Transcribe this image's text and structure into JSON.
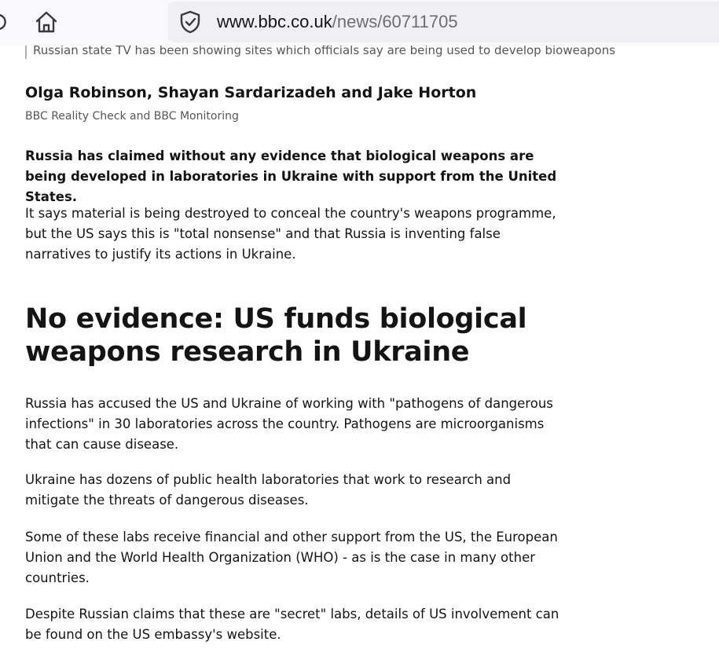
{
  "browser": {
    "url_host": "www.bbc.co.uk",
    "url_path": "/news/60711705"
  },
  "article": {
    "image_caption": "Russian state TV has been showing sites which officials say are being used to develop bioweapons",
    "byline": "Olga Robinson, Shayan Sardarizadeh and Jake Horton",
    "affiliation": "BBC Reality Check and BBC Monitoring",
    "intro": "Russia has claimed without any evidence that biological weapons are being developed in laboratories in Ukraine with support from the United States.",
    "paragraph_1": "It says material is being destroyed to conceal the country's weapons programme, but the US says this is \"total nonsense\" and that Russia is inventing false narratives to justify its actions in Ukraine.",
    "heading": "No evidence: US funds biological weapons research in Ukraine",
    "paragraph_2": "Russia has accused the US and Ukraine of working with \"pathogens of dangerous infections\" in 30 laboratories across the country. Pathogens are microorganisms that can cause disease.",
    "paragraph_3": "Ukraine has dozens of public health laboratories that work to research and mitigate the threats of dangerous diseases.",
    "paragraph_4": "Some of these labs receive financial and other support from the US, the European Union and the World Health Organization (WHO) - as is the case in many other countries.",
    "paragraph_5": "Despite Russian claims that these are \"secret\" labs, details of US involvement can be found on the US embassy's website."
  },
  "icons": {
    "reload": "reload-icon",
    "home": "home-icon",
    "security": "shield-check-icon"
  }
}
